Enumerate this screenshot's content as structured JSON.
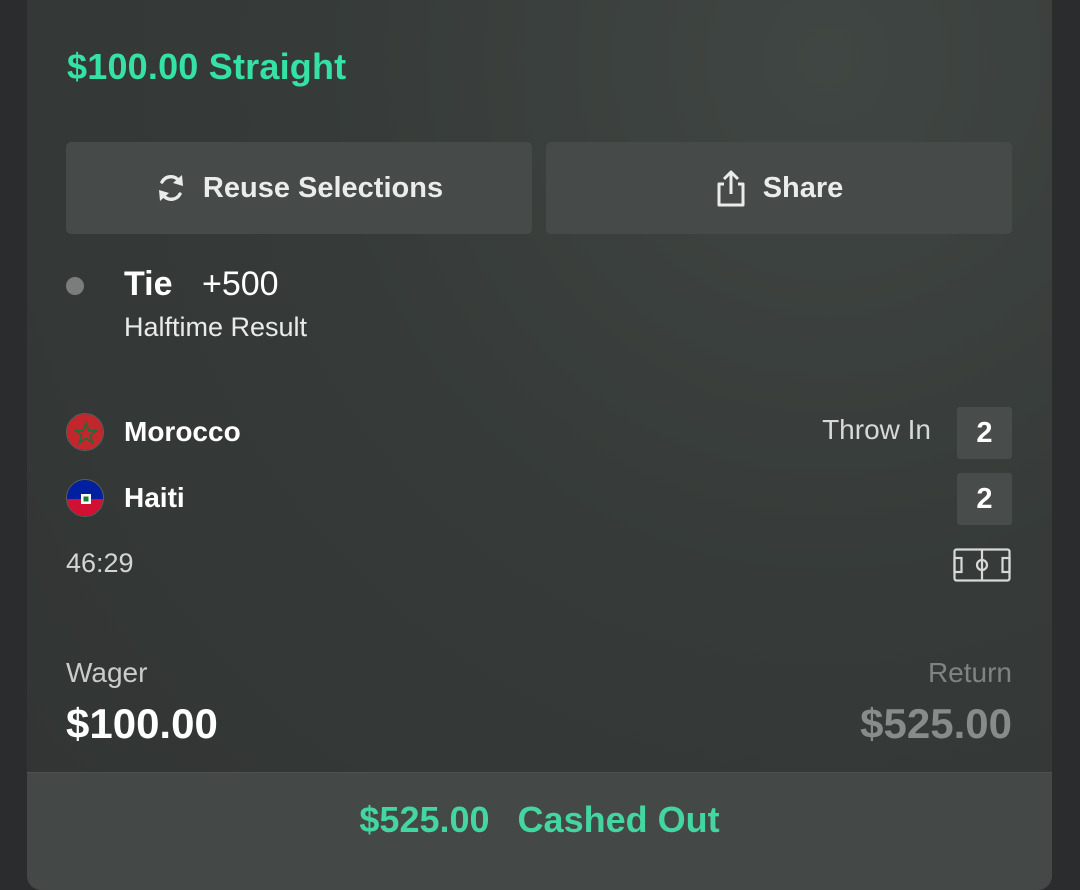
{
  "bet": {
    "title": "$100.00 Straight"
  },
  "actions": {
    "reuse_label": "Reuse Selections",
    "share_label": "Share"
  },
  "selection": {
    "name": "Tie",
    "odds": "+500",
    "market": "Halftime Result"
  },
  "match": {
    "teams": [
      {
        "name": "Morocco",
        "score": "2"
      },
      {
        "name": "Haiti",
        "score": "2"
      }
    ],
    "status": "Throw In",
    "clock": "46:29"
  },
  "wager": {
    "label": "Wager",
    "value": "$100.00"
  },
  "return": {
    "label": "Return",
    "value": "$525.00"
  },
  "cashout": {
    "amount": "$525.00",
    "label": "Cashed Out"
  },
  "colors": {
    "accent": "#35e2a5",
    "card_background": "#363b39",
    "button_background": "#464a48"
  },
  "icons": {
    "reuse": "refresh-icon",
    "share": "share-icon",
    "pitch": "soccer-pitch-icon"
  }
}
